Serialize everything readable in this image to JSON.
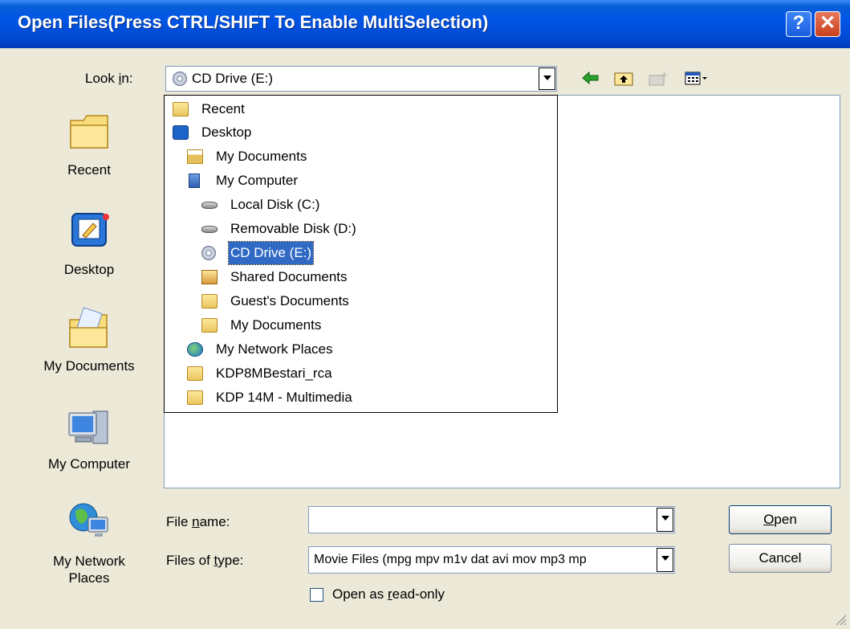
{
  "dialog": {
    "title": "Open Files(Press CTRL/SHIFT To Enable MultiSelection)",
    "help_label": "?",
    "close_label": "✕"
  },
  "look_in": {
    "label_prefix": "Look ",
    "label_mnemonic": "i",
    "label_suffix": "n:",
    "value": "CD Drive (E:)"
  },
  "toolbar": {
    "icons": [
      "back-arrow-icon",
      "up-one-level-icon",
      "create-new-folder-icon",
      "view-menu-icon"
    ]
  },
  "dropdown_items": [
    {
      "label": "Recent",
      "icon": "folder-icon"
    },
    {
      "label": "Desktop",
      "icon": "desktop-icon"
    },
    {
      "label": "My Documents",
      "icon": "my-documents-icon"
    },
    {
      "label": "My Computer",
      "icon": "my-computer-icon"
    },
    {
      "label": "Local Disk (C:)",
      "icon": "hard-disk-icon"
    },
    {
      "label": "Removable Disk (D:)",
      "icon": "removable-disk-icon"
    },
    {
      "label": "CD Drive (E:)",
      "icon": "cd-drive-icon",
      "selected": true
    },
    {
      "label": "Shared Documents",
      "icon": "shared-folder-icon"
    },
    {
      "label": "Guest's Documents",
      "icon": "folder-icon"
    },
    {
      "label": "My Documents",
      "icon": "folder-icon"
    },
    {
      "label": "My Network Places",
      "icon": "network-places-icon"
    },
    {
      "label": "KDP8MBestari_rca",
      "icon": "folder-icon"
    },
    {
      "label": "KDP 14M - Multimedia",
      "icon": "folder-icon"
    }
  ],
  "places": [
    {
      "label": "Recent",
      "icon": "recent-folder-icon"
    },
    {
      "label": "Desktop",
      "icon": "desktop-icon"
    },
    {
      "label": "My Documents",
      "icon": "my-documents-icon"
    },
    {
      "label": "My Computer",
      "icon": "my-computer-icon"
    },
    {
      "label_line1": "My Network",
      "label_line2": "Places",
      "icon": "network-places-icon"
    }
  ],
  "file_name": {
    "label_prefix": "File ",
    "label_mnemonic": "n",
    "label_suffix": "ame:",
    "value": ""
  },
  "files_of_type": {
    "label_prefix": "Files of ",
    "label_mnemonic": "t",
    "label_suffix": "ype:",
    "value": "Movie Files (mpg mpv m1v dat avi mov mp3 mp"
  },
  "buttons": {
    "open_mnemonic": "O",
    "open_rest": "pen",
    "cancel": "Cancel"
  },
  "read_only": {
    "label_prefix": "Open as ",
    "label_mnemonic": "r",
    "label_suffix": "ead-only",
    "checked": false
  }
}
